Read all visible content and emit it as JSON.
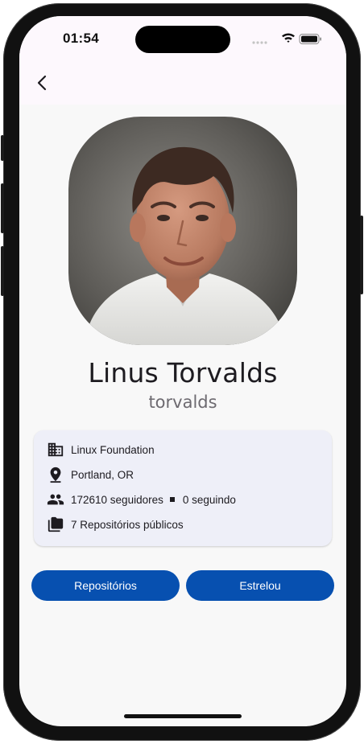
{
  "status_bar": {
    "time": "01:54"
  },
  "app_bar": {
    "back_icon": "chevron-left-icon"
  },
  "profile": {
    "name": "Linus Torvalds",
    "login": "torvalds"
  },
  "info": {
    "company": {
      "icon": "building-icon",
      "text": "Linux Foundation"
    },
    "location": {
      "icon": "location-pin-icon",
      "text": "Portland, OR"
    },
    "followers": {
      "icon": "people-icon",
      "followers_text": "172610 seguidores",
      "following_text": "0 seguindo"
    },
    "repos": {
      "icon": "folder-icon",
      "text": "7 Repositórios públicos"
    }
  },
  "actions": {
    "repositories_label": "Repositórios",
    "starred_label": "Estrelou"
  },
  "colors": {
    "primary": "#0750b0",
    "card_bg": "#eeeff8",
    "background": "#f8f8f8"
  }
}
